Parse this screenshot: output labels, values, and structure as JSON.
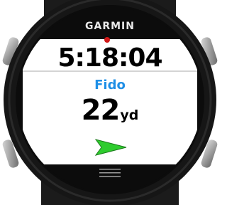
{
  "device": {
    "brand": "GARMIN",
    "colors": {
      "bezel": "#1b1b1b",
      "screen": "#ffffff",
      "accent_text": "#1f8fe6",
      "arrow": "#2ecc2e",
      "gps_dot": "#d01818"
    }
  },
  "screen": {
    "time": "5:18:04",
    "target_name": "Fido",
    "distance_value": "22",
    "distance_unit": "yd",
    "direction_icon": "green-arrow-right-icon",
    "menu_icon": "menu-lines-icon"
  }
}
